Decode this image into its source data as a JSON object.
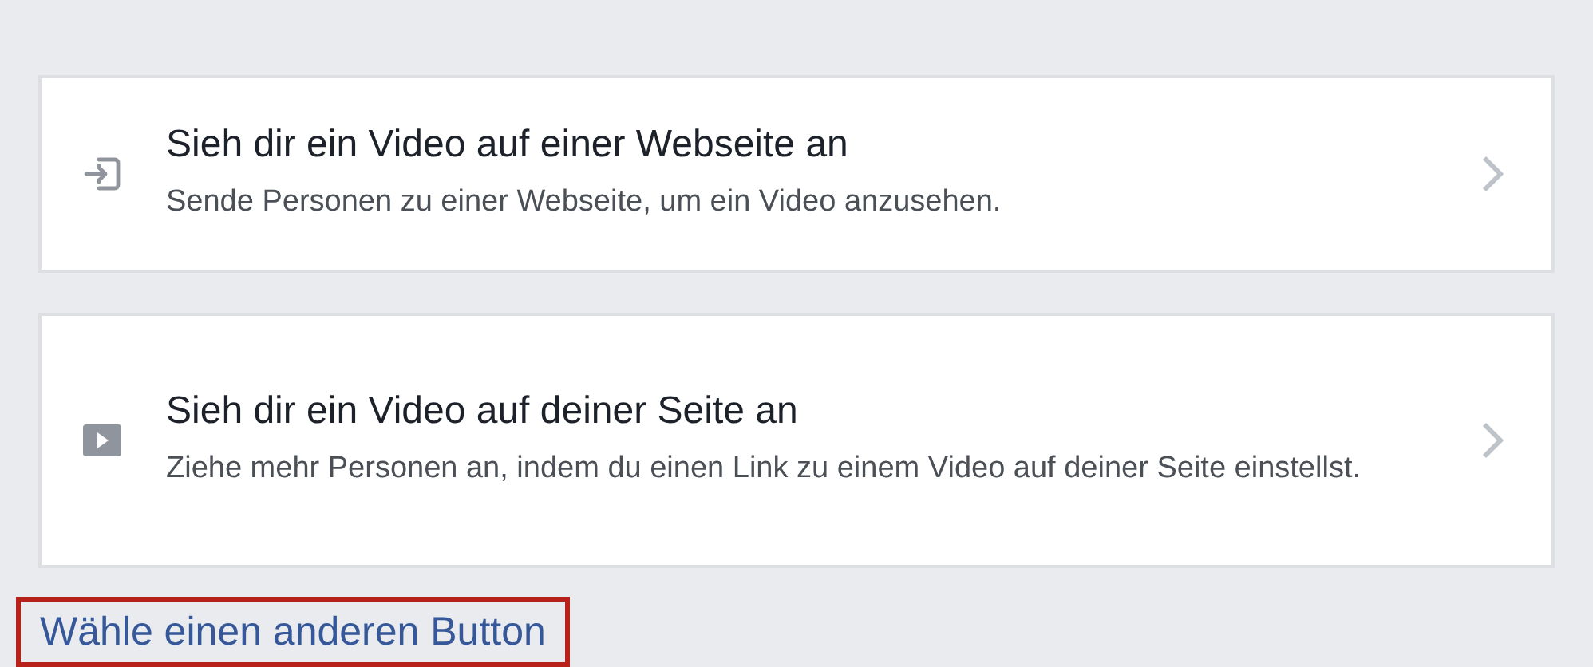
{
  "options": [
    {
      "kind": "website",
      "title": "Sieh dir ein Video auf einer Webseite an",
      "description": "Sende Personen zu einer Webseite, um ein Video anzusehen."
    },
    {
      "kind": "video",
      "title": "Sieh dir ein Video auf deiner Seite an",
      "description": "Ziehe mehr Personen an, indem du einen Link zu einem Video auf deiner Seite einstellst."
    }
  ],
  "link": {
    "label": "Wähle einen anderen Button",
    "highlighted": true
  }
}
